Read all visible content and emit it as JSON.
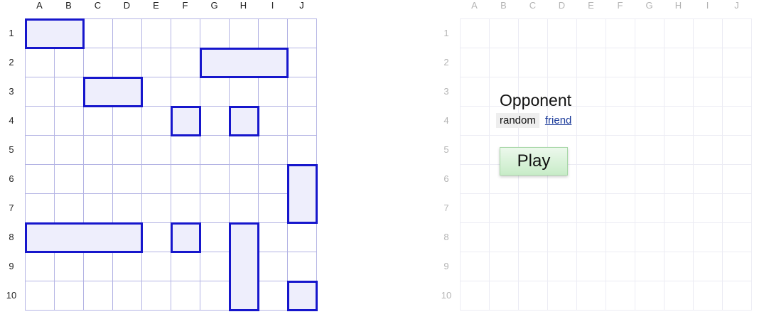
{
  "columns": [
    "A",
    "B",
    "C",
    "D",
    "E",
    "F",
    "G",
    "H",
    "I",
    "J"
  ],
  "rows": [
    "1",
    "2",
    "3",
    "4",
    "5",
    "6",
    "7",
    "8",
    "9",
    "10"
  ],
  "own_ships": [
    {
      "col": "A",
      "row": 1,
      "length": 2,
      "orientation": "horizontal"
    },
    {
      "col": "G",
      "row": 2,
      "length": 3,
      "orientation": "horizontal"
    },
    {
      "col": "C",
      "row": 3,
      "length": 2,
      "orientation": "horizontal"
    },
    {
      "col": "F",
      "row": 4,
      "length": 1,
      "orientation": "horizontal"
    },
    {
      "col": "H",
      "row": 4,
      "length": 1,
      "orientation": "horizontal"
    },
    {
      "col": "J",
      "row": 6,
      "length": 2,
      "orientation": "vertical"
    },
    {
      "col": "A",
      "row": 8,
      "length": 4,
      "orientation": "horizontal"
    },
    {
      "col": "F",
      "row": 8,
      "length": 1,
      "orientation": "horizontal"
    },
    {
      "col": "H",
      "row": 8,
      "length": 3,
      "orientation": "vertical"
    },
    {
      "col": "J",
      "row": 10,
      "length": 1,
      "orientation": "horizontal"
    }
  ],
  "opponent": {
    "title": "Opponent",
    "options": {
      "random": "random",
      "friend": "friend"
    },
    "selected": "random"
  },
  "play_label": "Play",
  "colors": {
    "ship_border": "#1616cc",
    "ship_fill": "#eeeefc",
    "own_grid_line": "#b4b4e4",
    "enemy_grid_line": "#ececf4",
    "play_button": "#c8ecc8",
    "link": "#1a3a9a"
  }
}
